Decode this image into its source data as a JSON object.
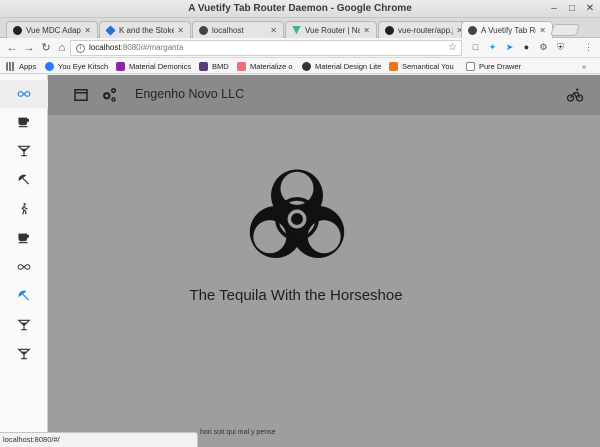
{
  "window": {
    "title": "A Vuetify Tab Router Daemon - Google Chrome"
  },
  "tabs": [
    {
      "label": "Vue MDC Adapte",
      "icon": "github-icon"
    },
    {
      "label": "K and the Stoke",
      "icon": "vuetify-icon"
    },
    {
      "label": "localhost",
      "icon": "biohazard-icon"
    },
    {
      "label": "Vue Router | Na",
      "icon": "vue-icon"
    },
    {
      "label": "vue-router/app.j",
      "icon": "github-icon"
    },
    {
      "label": "A Vuetify Tab Ro",
      "icon": "biohazard-icon",
      "active": true
    }
  ],
  "address": {
    "host": "localhost",
    "path": ":8080/#/marganta"
  },
  "bookmarks": [
    {
      "label": "Apps",
      "icon": "apps-grid-icon"
    },
    {
      "label": "You Eye Kitsch",
      "icon": "refresh-icon"
    },
    {
      "label": "Material Demonics",
      "icon": "purple-square-icon"
    },
    {
      "label": "BMD",
      "icon": "b-icon"
    },
    {
      "label": "Materialize o",
      "icon": "m-icon"
    },
    {
      "label": "Material Design Lite",
      "icon": "mdl-icon"
    },
    {
      "label": "Semantical You",
      "icon": "s-icon"
    },
    {
      "label": "Pure Drawer",
      "icon": "page-icon"
    }
  ],
  "app": {
    "title": "Engenho Novo LLC",
    "headline": "The Tequila With the Horseshoe",
    "footer": "hori soit qui mal y pense",
    "drawer_items": [
      {
        "icon": "infinity-icon",
        "selected": true
      },
      {
        "icon": "coffee-icon"
      },
      {
        "icon": "cocktail-icon"
      },
      {
        "icon": "beach-icon"
      },
      {
        "icon": "walk-icon"
      },
      {
        "icon": "coffee-icon"
      },
      {
        "icon": "infinity-icon"
      },
      {
        "icon": "beach-icon",
        "accent": true
      },
      {
        "icon": "cocktail-icon"
      },
      {
        "icon": "cocktail-icon"
      }
    ]
  },
  "status": "localhost:8080/#/",
  "colors": {
    "accent": "#1e88e5",
    "appbar": "#8a8a8a",
    "content": "#9e9e9e"
  }
}
